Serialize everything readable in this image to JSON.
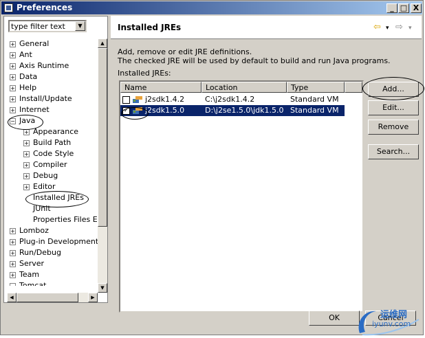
{
  "window": {
    "title": "Preferences",
    "minimize": "_",
    "maximize": "□",
    "close": "X"
  },
  "filter": {
    "value": "type filter text"
  },
  "tree": {
    "items": [
      {
        "label": "General",
        "toggle": "+"
      },
      {
        "label": "Ant",
        "toggle": "+"
      },
      {
        "label": "Axis Runtime",
        "toggle": "+"
      },
      {
        "label": "Data",
        "toggle": "+"
      },
      {
        "label": "Help",
        "toggle": "+"
      },
      {
        "label": "Install/Update",
        "toggle": "+"
      },
      {
        "label": "Internet",
        "toggle": "+"
      },
      {
        "label": "Java",
        "toggle": "−"
      },
      {
        "label": "Appearance",
        "toggle": "+"
      },
      {
        "label": "Build Path",
        "toggle": "+"
      },
      {
        "label": "Code Style",
        "toggle": "+"
      },
      {
        "label": "Compiler",
        "toggle": "+"
      },
      {
        "label": "Debug",
        "toggle": "+"
      },
      {
        "label": "Editor",
        "toggle": "+"
      },
      {
        "label": "Installed JREs",
        "toggle": ""
      },
      {
        "label": "JUnit",
        "toggle": ""
      },
      {
        "label": "Properties Files Edi",
        "toggle": ""
      },
      {
        "label": "Lomboz",
        "toggle": "+"
      },
      {
        "label": "Plug-in Development",
        "toggle": "+"
      },
      {
        "label": "Run/Debug",
        "toggle": "+"
      },
      {
        "label": "Server",
        "toggle": "+"
      },
      {
        "label": "Team",
        "toggle": "+"
      },
      {
        "label": "Tomcat",
        "toggle": "−"
      }
    ]
  },
  "page": {
    "title": "Installed JREs",
    "desc1": "Add, remove or edit JRE definitions.",
    "desc2": "The checked JRE will be used by default to build and run Java programs.",
    "list_label": "Installed JREs:"
  },
  "table": {
    "columns": [
      "Name",
      "Location",
      "Type"
    ],
    "rows": [
      {
        "name": "j2sdk1.4.2",
        "location": "C:\\j2sdk1.4.2",
        "type": "Standard VM",
        "checked": "",
        "selected": false
      },
      {
        "name": "j2sdk1.5.0",
        "location": "D:\\j2se1.5.0\\jdk1.5.0",
        "type": "Standard VM",
        "checked": "✓",
        "selected": true
      }
    ]
  },
  "buttons": {
    "add": "Add...",
    "edit": "Edit...",
    "remove": "Remove",
    "search": "Search...",
    "ok": "OK",
    "cancel": "Cancel"
  },
  "watermark": {
    "line1": "运维网",
    "line2": "iyunv.com"
  },
  "colors": {
    "selection": "#0a246a",
    "titlebar": "#0a246a",
    "dialog": "#d4d0c8"
  }
}
